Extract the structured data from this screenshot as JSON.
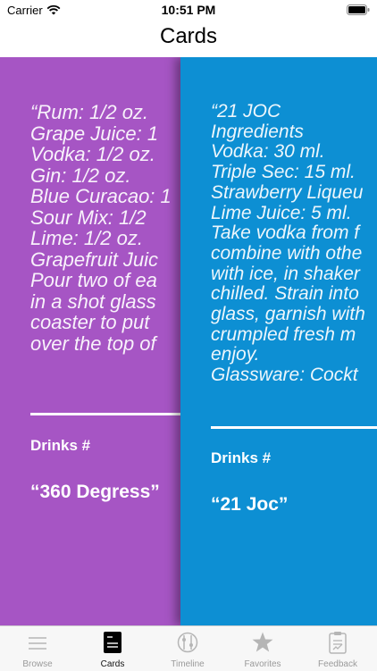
{
  "status_bar": {
    "carrier": "Carrier",
    "time": "10:51 PM"
  },
  "nav": {
    "title": "Cards"
  },
  "cards": [
    {
      "recipe_text": "“Rum: 1/2 oz.\nGrape Juice: 1\nVodka: 1/2 oz.\nGin: 1/2 oz.\nBlue Curacao: 1\nSour Mix: 1/2\nLime: 1/2 oz.\nGrapefruit Juic\nPour two of ea\nin a shot glass\ncoaster to put\nover the top of",
      "drinks_label": "Drinks #",
      "name": "“360 Degress”",
      "color": "#a655c4"
    },
    {
      "recipe_text": "“21 JOC\nIngredients\nVodka: 30 ml.\nTriple Sec: 15 ml.\nStrawberry Liqueu\nLime Juice: 5 ml.\nTake vodka from f\ncombine with othe\nwith ice, in shaker\nchilled. Strain into\nglass, garnish with\ncrumpled fresh m\nenjoy.\nGlassware: Cockt",
      "drinks_label": "Drinks #",
      "name": "“21 Joc”",
      "color": "#0d8fd3"
    }
  ],
  "pager": {
    "pages": 2,
    "current": 2
  },
  "tabs": [
    {
      "label": "Browse",
      "icon": "list-icon",
      "active": false
    },
    {
      "label": "Cards",
      "icon": "cards-icon",
      "active": true
    },
    {
      "label": "Timeline",
      "icon": "timeline-icon",
      "active": false
    },
    {
      "label": "Favorites",
      "icon": "star-icon",
      "active": false
    },
    {
      "label": "Feedback",
      "icon": "clipboard-icon",
      "active": false
    }
  ]
}
